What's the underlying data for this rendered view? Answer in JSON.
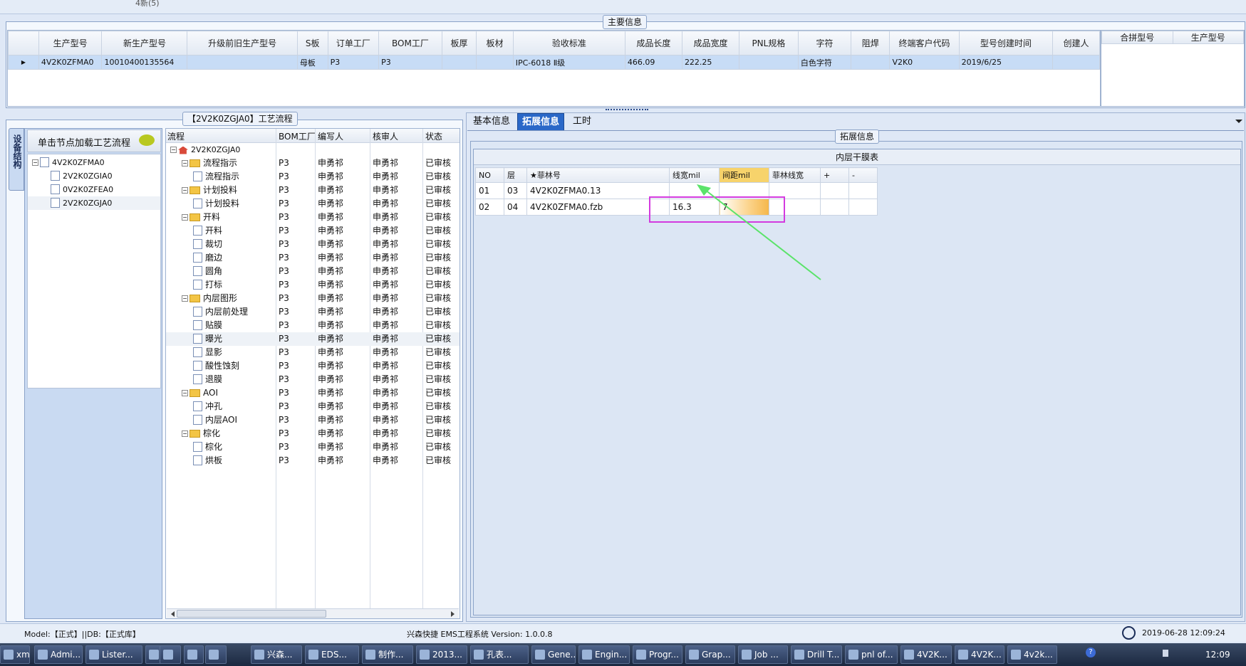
{
  "main_info": {
    "title": "主要信息",
    "columns": [
      "生产型号",
      "新生产型号",
      "升级前旧生产型号",
      "S板",
      "订单工厂",
      "BOM工厂",
      "板厚",
      "板材",
      "验收标准",
      "成品长度",
      "成品宽度",
      "PNL规格",
      "字符",
      "阻焊",
      "终端客户代码",
      "型号创建时间",
      "创建人"
    ],
    "row": [
      "4V2K0ZFMA0",
      "10010400135564",
      "",
      "母板",
      "P3",
      "P3",
      "",
      "",
      "IPC-6018 Ⅱ级",
      "466.09",
      "222.25",
      "",
      "白色字符",
      "",
      "V2K0",
      "2019/6/25",
      ""
    ],
    "side_columns": [
      "合拼型号",
      "生产型号"
    ]
  },
  "process": {
    "title": "【2V2K0ZGJA0】工艺流程",
    "load_hint": "单击节点加载工艺流程",
    "side_tab": "设备结构",
    "tree": [
      "4V2K0ZFMA0",
      "2V2K0ZGIA0",
      "0V2K0ZFEA0",
      "2V2K0ZGJA0"
    ],
    "flow_columns": [
      "流程",
      "BOM工厂",
      "编写人",
      "核审人",
      "状态"
    ],
    "flow_root": "2V2K0ZGJA0",
    "flow_rows": [
      {
        "name": "流程指示",
        "level": 1,
        "folder": true,
        "bom": "P3",
        "writer": "申勇祁",
        "reviewer": "申勇祁",
        "status": "已审核"
      },
      {
        "name": "流程指示",
        "level": 2,
        "folder": false,
        "bom": "P3",
        "writer": "申勇祁",
        "reviewer": "申勇祁",
        "status": "已审核"
      },
      {
        "name": "计划投料",
        "level": 1,
        "folder": true,
        "bom": "P3",
        "writer": "申勇祁",
        "reviewer": "申勇祁",
        "status": "已审核"
      },
      {
        "name": "计划投料",
        "level": 2,
        "folder": false,
        "bom": "P3",
        "writer": "申勇祁",
        "reviewer": "申勇祁",
        "status": "已审核"
      },
      {
        "name": "开料",
        "level": 1,
        "folder": true,
        "bom": "P3",
        "writer": "申勇祁",
        "reviewer": "申勇祁",
        "status": "已审核"
      },
      {
        "name": "开料",
        "level": 2,
        "folder": false,
        "bom": "P3",
        "writer": "申勇祁",
        "reviewer": "申勇祁",
        "status": "已审核"
      },
      {
        "name": "裁切",
        "level": 2,
        "folder": false,
        "bom": "P3",
        "writer": "申勇祁",
        "reviewer": "申勇祁",
        "status": "已审核"
      },
      {
        "name": "磨边",
        "level": 2,
        "folder": false,
        "bom": "P3",
        "writer": "申勇祁",
        "reviewer": "申勇祁",
        "status": "已审核"
      },
      {
        "name": "圆角",
        "level": 2,
        "folder": false,
        "bom": "P3",
        "writer": "申勇祁",
        "reviewer": "申勇祁",
        "status": "已审核"
      },
      {
        "name": "打标",
        "level": 2,
        "folder": false,
        "bom": "P3",
        "writer": "申勇祁",
        "reviewer": "申勇祁",
        "status": "已审核"
      },
      {
        "name": "内层图形",
        "level": 1,
        "folder": true,
        "bom": "P3",
        "writer": "申勇祁",
        "reviewer": "申勇祁",
        "status": "已审核"
      },
      {
        "name": "内层前处理",
        "level": 2,
        "folder": false,
        "bom": "P3",
        "writer": "申勇祁",
        "reviewer": "申勇祁",
        "status": "已审核"
      },
      {
        "name": "贴膜",
        "level": 2,
        "folder": false,
        "bom": "P3",
        "writer": "申勇祁",
        "reviewer": "申勇祁",
        "status": "已审核"
      },
      {
        "name": "曝光",
        "level": 2,
        "folder": false,
        "bom": "P3",
        "writer": "申勇祁",
        "reviewer": "申勇祁",
        "status": "已审核",
        "selected": true
      },
      {
        "name": "显影",
        "level": 2,
        "folder": false,
        "bom": "P3",
        "writer": "申勇祁",
        "reviewer": "申勇祁",
        "status": "已审核"
      },
      {
        "name": "酸性蚀刻",
        "level": 2,
        "folder": false,
        "bom": "P3",
        "writer": "申勇祁",
        "reviewer": "申勇祁",
        "status": "已审核"
      },
      {
        "name": "退膜",
        "level": 2,
        "folder": false,
        "bom": "P3",
        "writer": "申勇祁",
        "reviewer": "申勇祁",
        "status": "已审核"
      },
      {
        "name": "AOI",
        "level": 1,
        "folder": true,
        "bom": "P3",
        "writer": "申勇祁",
        "reviewer": "申勇祁",
        "status": "已审核"
      },
      {
        "name": "冲孔",
        "level": 2,
        "folder": false,
        "bom": "P3",
        "writer": "申勇祁",
        "reviewer": "申勇祁",
        "status": "已审核"
      },
      {
        "name": "内层AOI",
        "level": 2,
        "folder": false,
        "bom": "P3",
        "writer": "申勇祁",
        "reviewer": "申勇祁",
        "status": "已审核"
      },
      {
        "name": "棕化",
        "level": 1,
        "folder": true,
        "bom": "P3",
        "writer": "申勇祁",
        "reviewer": "申勇祁",
        "status": "已审核"
      },
      {
        "name": "棕化",
        "level": 2,
        "folder": false,
        "bom": "P3",
        "writer": "申勇祁",
        "reviewer": "申勇祁",
        "status": "已审核"
      },
      {
        "name": "烘板",
        "level": 2,
        "folder": false,
        "bom": "P3",
        "writer": "申勇祁",
        "reviewer": "申勇祁",
        "status": "已审核"
      }
    ]
  },
  "right": {
    "tabs": [
      "基本信息",
      "拓展信息",
      "工时"
    ],
    "active_tab": 1,
    "group_title": "拓展信息",
    "table_title": "内层干膜表",
    "columns": [
      "NO",
      "层",
      "★菲林号",
      "线宽mil",
      "间距mil",
      "菲林线宽",
      "+",
      "-"
    ],
    "rows": [
      [
        "01",
        "03",
        "4V2K0ZFMA0.13",
        "",
        "",
        "",
        "",
        ""
      ],
      [
        "02",
        "04",
        "4V2K0ZFMA0.fzb",
        "16.3",
        "7",
        "",
        "",
        ""
      ]
    ]
  },
  "status_bar": {
    "left": "Model:【正式】||DB:【正式库】",
    "center": "兴森快捷 EMS工程系统 Version: 1.0.0.8",
    "right": "2019-06-28 12:09:24"
  },
  "top_strip_text": "4新(5)",
  "taskbar": {
    "items": [
      "xm...",
      "Admi...",
      "Lister...",
      "",
      "",
      "",
      "",
      "兴森...",
      "EDS...",
      "制作...",
      "2013...",
      "孔表...",
      "Gene...",
      "Engin...",
      "Progr...",
      "Grap...",
      "Job ...",
      "Drill T...",
      "pnl of...",
      "4V2K...",
      "4V2K...",
      "4v2k..."
    ],
    "clock": "12:09"
  }
}
